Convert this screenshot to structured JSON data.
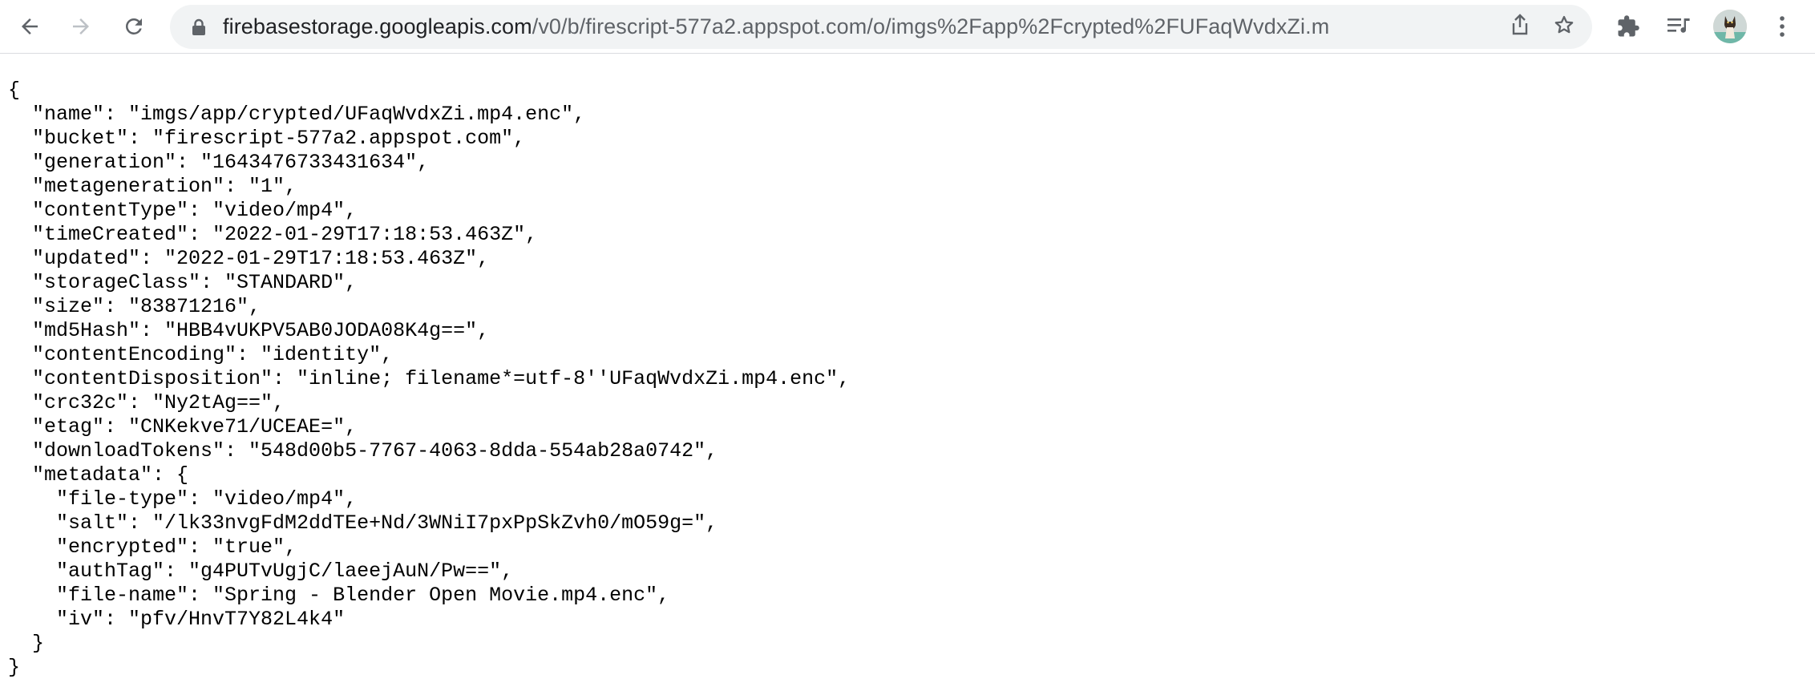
{
  "browser": {
    "url_host": "firebasestorage.googleapis.com",
    "url_path": "/v0/b/firescript-577a2.appspot.com/o/imgs%2Fapp%2Fcrypted%2FUFaqWvdxZi.mp...",
    "icons": {
      "back": "arrow-left-icon",
      "forward": "arrow-right-icon",
      "reload": "reload-icon",
      "lock": "lock-icon",
      "share": "share-icon",
      "bookmark": "star-icon",
      "extensions": "puzzle-icon",
      "media": "media-queue-icon",
      "profile": "avatar",
      "menu": "kebab-menu-icon"
    }
  },
  "json_lines": [
    "{",
    "  \"name\": \"imgs/app/crypted/UFaqWvdxZi.mp4.enc\",",
    "  \"bucket\": \"firescript-577a2.appspot.com\",",
    "  \"generation\": \"1643476733431634\",",
    "  \"metageneration\": \"1\",",
    "  \"contentType\": \"video/mp4\",",
    "  \"timeCreated\": \"2022-01-29T17:18:53.463Z\",",
    "  \"updated\": \"2022-01-29T17:18:53.463Z\",",
    "  \"storageClass\": \"STANDARD\",",
    "  \"size\": \"83871216\",",
    "  \"md5Hash\": \"HBB4vUKPV5AB0JODA08K4g==\",",
    "  \"contentEncoding\": \"identity\",",
    "  \"contentDisposition\": \"inline; filename*=utf-8''UFaqWvdxZi.mp4.enc\",",
    "  \"crc32c\": \"Ny2tAg==\",",
    "  \"etag\": \"CNKekve71/UCEAE=\",",
    "  \"downloadTokens\": \"548d00b5-7767-4063-8dda-554ab28a0742\",",
    "  \"metadata\": {",
    "    \"file-type\": \"video/mp4\",",
    "    \"salt\": \"/lk33nvgFdM2ddTEe+Nd/3WNiI7pxPpSkZvh0/mO59g=\",",
    "    \"encrypted\": \"true\",",
    "    \"authTag\": \"g4PUTvUgjC/laeejAuN/Pw==\",",
    "    \"file-name\": \"Spring - Blender Open Movie.mp4.enc\",",
    "    \"iv\": \"pfv/HnvT7Y82L4k4\"",
    "  }",
    "}"
  ]
}
